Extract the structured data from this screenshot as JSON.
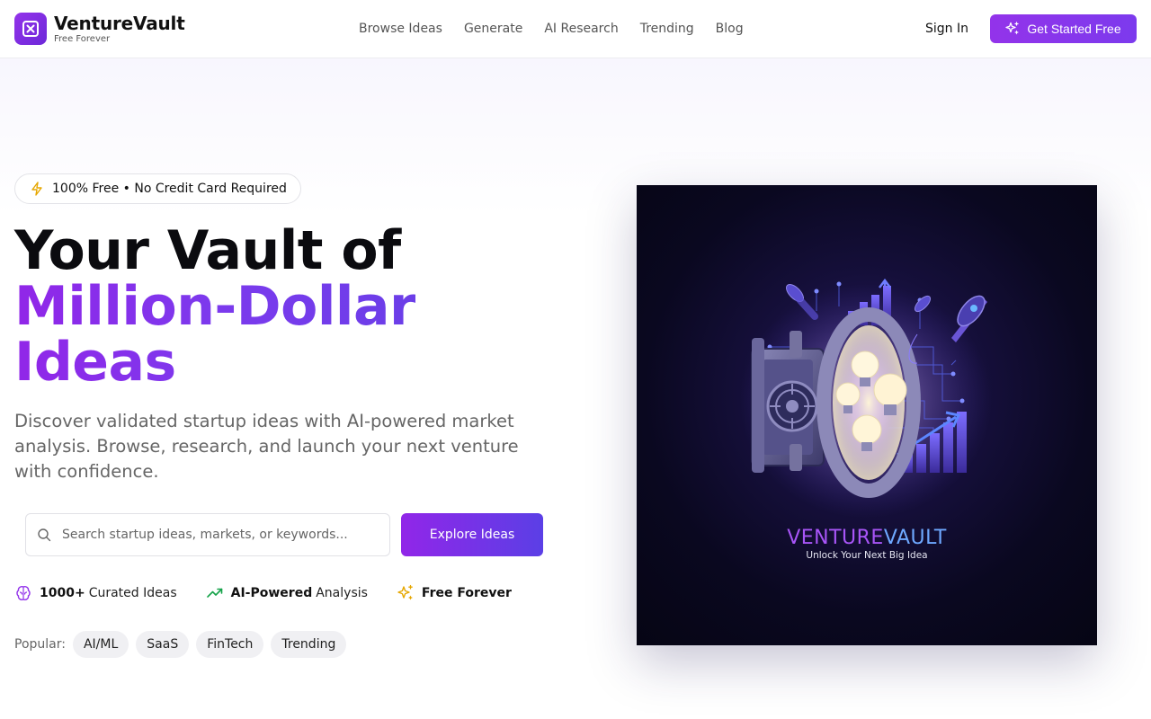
{
  "brand": {
    "name": "VentureVault",
    "tagline": "Free Forever",
    "logo_icon": "x-square-icon"
  },
  "nav": {
    "items": [
      "Browse Ideas",
      "Generate",
      "AI Research",
      "Trending",
      "Blog"
    ]
  },
  "header": {
    "sign_in": "Sign In",
    "cta": "Get Started Free",
    "cta_icon": "sparkles-icon"
  },
  "hero": {
    "badge": "100% Free • No Credit Card Required",
    "badge_icon": "lightning-icon",
    "title_line1": "Your Vault of",
    "title_line2": "Million-Dollar",
    "title_line3": "Ideas",
    "subtitle": "Discover validated startup ideas with AI-powered market analysis. Browse, research, and launch your next venture with confidence.",
    "search_placeholder": "Search startup ideas, markets, or keywords...",
    "search_value": "",
    "explore_button": "Explore Ideas",
    "features": [
      {
        "bold": "1000+",
        "text": "Curated Ideas",
        "icon": "brain-icon"
      },
      {
        "bold": "AI-Powered",
        "text": "Analysis",
        "icon": "trending-up-icon"
      },
      {
        "bold": "Free Forever",
        "text": "",
        "icon": "sparkles-icon"
      }
    ],
    "popular_label": "Popular:",
    "popular_tags": [
      "AI/ML",
      "SaaS",
      "FinTech",
      "Trending"
    ]
  },
  "illustration": {
    "wordmark_part1": "VENTURE",
    "wordmark_part2": "VAULT",
    "tagline": "Unlock Your Next Big Idea"
  },
  "colors": {
    "accent": "#9333ea",
    "accent_secondary": "#5b3fe6",
    "badge_icon": "#e6a700",
    "trend_icon": "#16a34a",
    "feature_brain": "#9333ea"
  }
}
